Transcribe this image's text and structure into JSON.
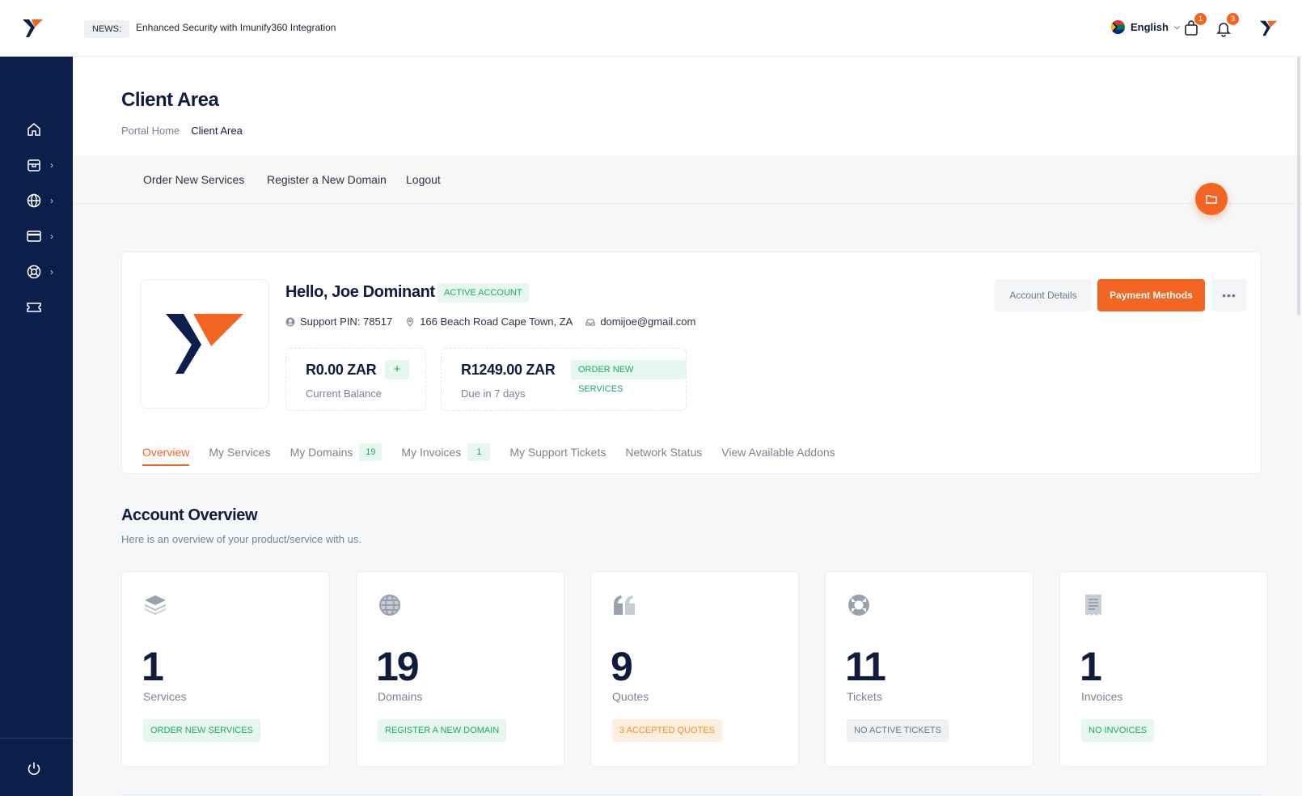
{
  "topbar": {
    "news_label": "NEWS:",
    "news_text": "Enhanced Security with Imunify360 Integration",
    "language": "English",
    "cart_count": "1",
    "notifications_count": "3"
  },
  "header": {
    "title": "Client Area",
    "breadcrumb": [
      "Portal Home",
      "Client Area"
    ]
  },
  "quicknav": [
    "Order New Services",
    "Register a New Domain",
    "Logout"
  ],
  "profile": {
    "greeting": "Hello, Joe Dominant",
    "status": "ACTIVE ACCOUNT",
    "support_pin": "Support PIN: 78517",
    "address": "166 Beach Road Cape Town, ZA",
    "email": "domijoe@gmail.com",
    "balance": {
      "amount": "R0.00 ZAR",
      "label": "Current Balance",
      "action": "+"
    },
    "due": {
      "amount": "R1249.00 ZAR",
      "label": "Due in 7 days",
      "action": "ORDER NEW SERVICES"
    },
    "buttons": {
      "account": "Account Details",
      "payment": "Payment Methods",
      "more": "•••"
    }
  },
  "tabs": [
    {
      "label": "Overview",
      "count": ""
    },
    {
      "label": "My Services",
      "count": ""
    },
    {
      "label": "My Domains",
      "count": "19"
    },
    {
      "label": "My Invoices",
      "count": "1"
    },
    {
      "label": "My Support Tickets",
      "count": ""
    },
    {
      "label": "Network Status",
      "count": ""
    },
    {
      "label": "View Available Addons",
      "count": ""
    }
  ],
  "overview": {
    "title": "Account Overview",
    "subtitle": "Here is an overview of your product/service with us.",
    "tiles": [
      {
        "icon": "layers-icon",
        "number": "1",
        "label": "Services",
        "pill": "ORDER NEW SERVICES",
        "pill_style": "green"
      },
      {
        "icon": "globe-icon",
        "number": "19",
        "label": "Domains",
        "pill": "REGISTER A NEW DOMAIN",
        "pill_style": "green"
      },
      {
        "icon": "quote-icon",
        "number": "9",
        "label": "Quotes",
        "pill": "3 ACCEPTED QUOTES",
        "pill_style": "orange"
      },
      {
        "icon": "lifebuoy-icon",
        "number": "11",
        "label": "Tickets",
        "pill": "NO ACTIVE TICKETS",
        "pill_style": "gray"
      },
      {
        "icon": "receipt-icon",
        "number": "1",
        "label": "Invoices",
        "pill": "NO INVOICES",
        "pill_style": "green"
      }
    ]
  },
  "colors": {
    "brand_navy": "#0c1e4a",
    "accent_orange": "#f26522",
    "success_green": "#1ea868"
  }
}
